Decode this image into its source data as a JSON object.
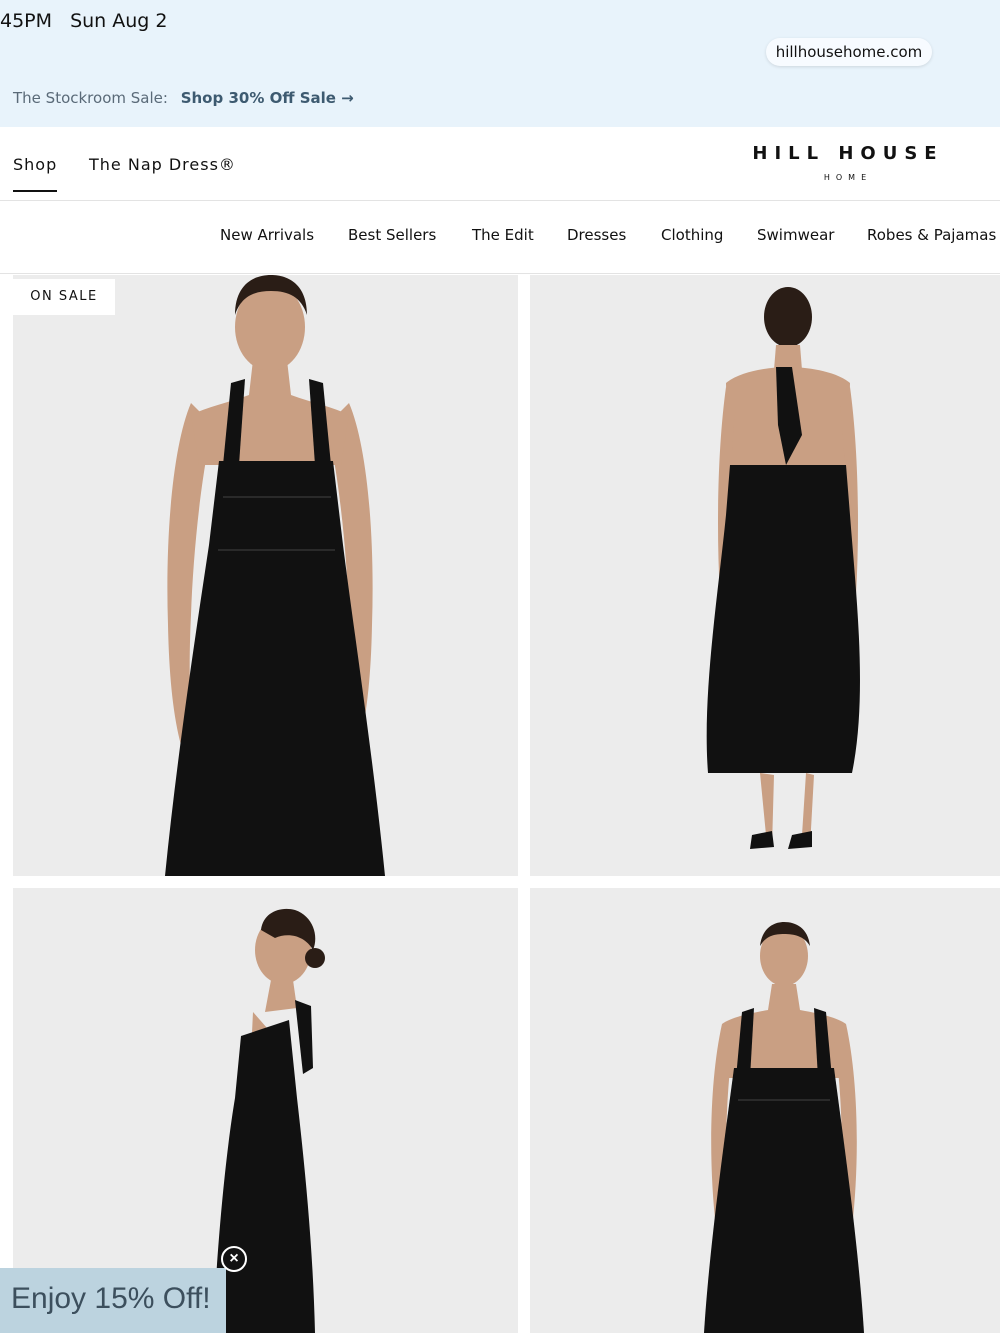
{
  "status_bar": {
    "time": "45PM",
    "date": "Sun Aug 2"
  },
  "browser": {
    "url": "hillhousehome.com"
  },
  "promo_banner": {
    "text": "The Stockroom Sale:",
    "link": "Shop 30% Off Sale →"
  },
  "header": {
    "tabs": [
      {
        "label": "Shop",
        "active": true
      },
      {
        "label": "The Nap Dress®",
        "active": false
      }
    ],
    "logo": {
      "name": "HILL HOUSE",
      "sub": "HOME"
    }
  },
  "subnav": {
    "items": [
      "New Arrivals",
      "Best Sellers",
      "The Edit",
      "Dresses",
      "Clothing",
      "Swimwear",
      "Robes & Pajamas"
    ]
  },
  "product": {
    "badge": "ON SALE",
    "images": [
      {
        "view": "front"
      },
      {
        "view": "back"
      },
      {
        "view": "side"
      },
      {
        "view": "front-full"
      }
    ]
  },
  "popup": {
    "text": "Enjoy 15% Off!",
    "close_icon": "close-circle-icon"
  },
  "colors": {
    "top_bar_bg": "#e8f3fb",
    "dress": "#111111",
    "photo_bg": "#ececec",
    "popup_bg": "#bcd3df"
  }
}
